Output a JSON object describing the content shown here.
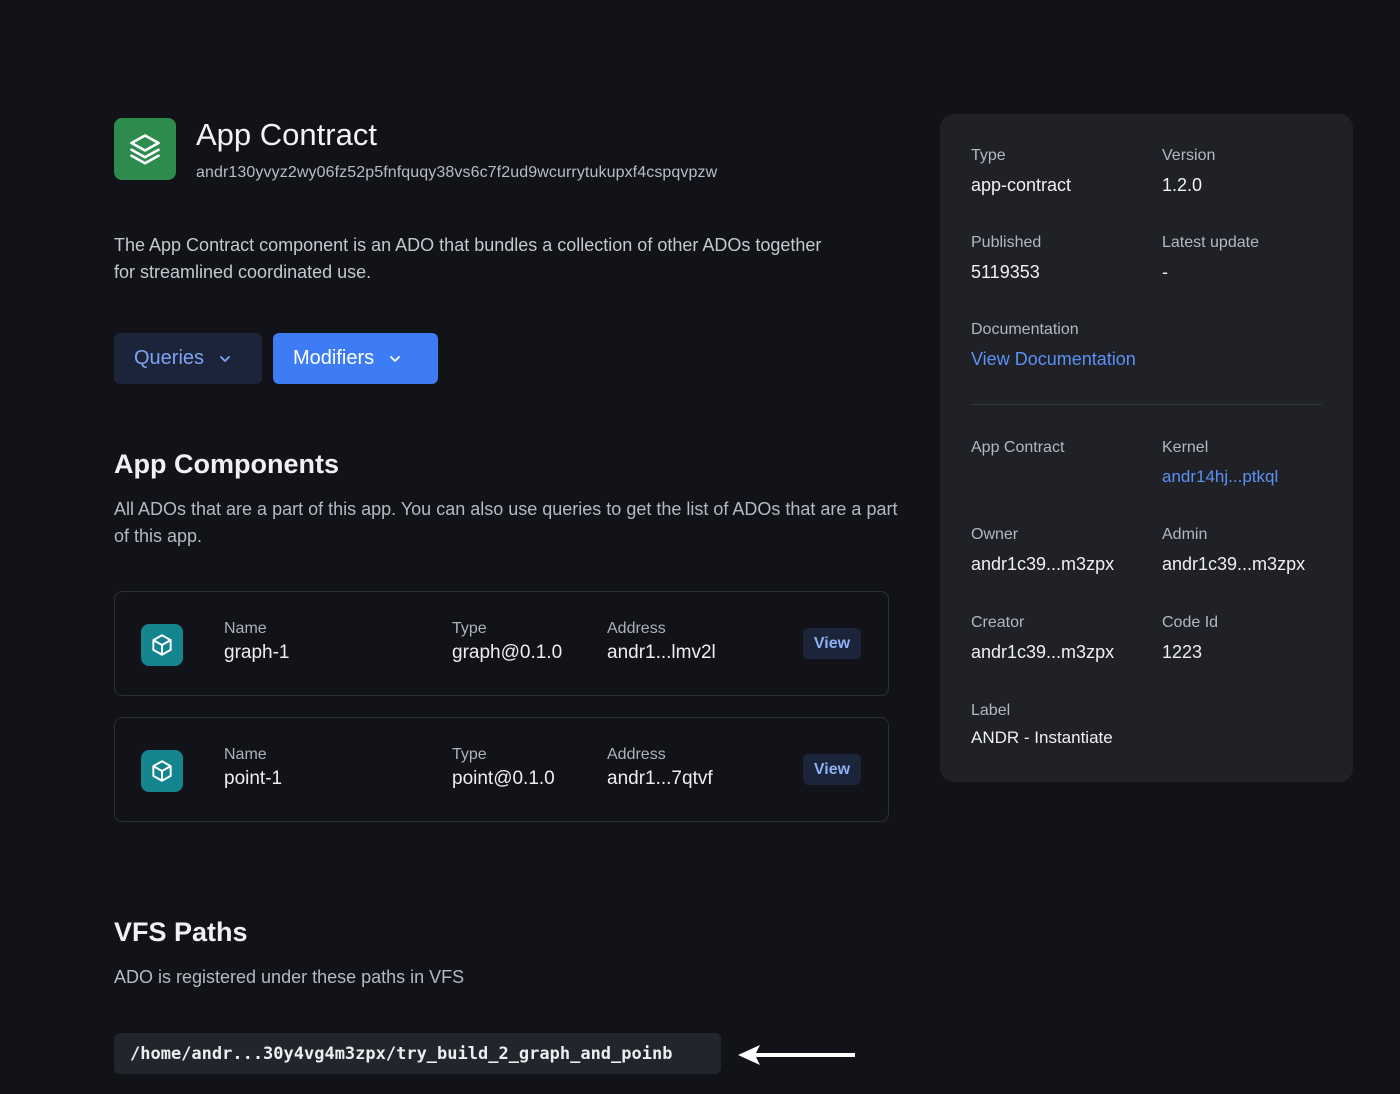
{
  "header": {
    "title": "App Contract",
    "address": "andr130yvyz2wy06fz52p5fnfquqy38vs6c7f2ud9wcurrytukupxf4cspqvpzw",
    "logo_icon": "layers-icon",
    "logo_color": "#2e8b4e"
  },
  "description": "The App Contract component is an ADO that bundles a collection of other ADOs together for streamlined coordinated use.",
  "buttons": {
    "queries": "Queries",
    "modifiers": "Modifiers"
  },
  "components": {
    "title": "App Components",
    "subtitle": "All ADOs that are a part of this app. You can also use queries to get the list of ADOs that are a part of this app.",
    "name_label": "Name",
    "type_label": "Type",
    "address_label": "Address",
    "view_label": "View",
    "items": [
      {
        "name": "graph-1",
        "type": "graph@0.1.0",
        "address": "andr1...lmv2l"
      },
      {
        "name": "point-1",
        "type": "point@0.1.0",
        "address": "andr1...7qtvf"
      }
    ]
  },
  "vfs": {
    "title": "VFS Paths",
    "subtitle": "ADO is registered under these paths in VFS",
    "path": "/home/andr...30y4vg4m3zpx/try_build_2_graph_and_poinb"
  },
  "panel": {
    "type_label": "Type",
    "type_value": "app-contract",
    "version_label": "Version",
    "version_value": "1.2.0",
    "published_label": "Published",
    "published_value": "5119353",
    "latest_label": "Latest update",
    "latest_value": "-",
    "doc_label": "Documentation",
    "doc_link": "View Documentation",
    "app_label": "App Contract",
    "kernel_label": "Kernel",
    "kernel_value": "andr14hj...ptkql",
    "owner_label": "Owner",
    "owner_value": "andr1c39...m3zpx",
    "admin_label": "Admin",
    "admin_value": "andr1c39...m3zpx",
    "creator_label": "Creator",
    "creator_value": "andr1c39...m3zpx",
    "codeid_label": "Code Id",
    "codeid_value": "1223",
    "label_label": "Label",
    "label_value": "ANDR - Instantiate"
  },
  "colors": {
    "background": "#121318",
    "panel": "#1f2127",
    "accent": "#3d7cf5",
    "link": "#5b91f5",
    "component_icon": "#14848f"
  }
}
